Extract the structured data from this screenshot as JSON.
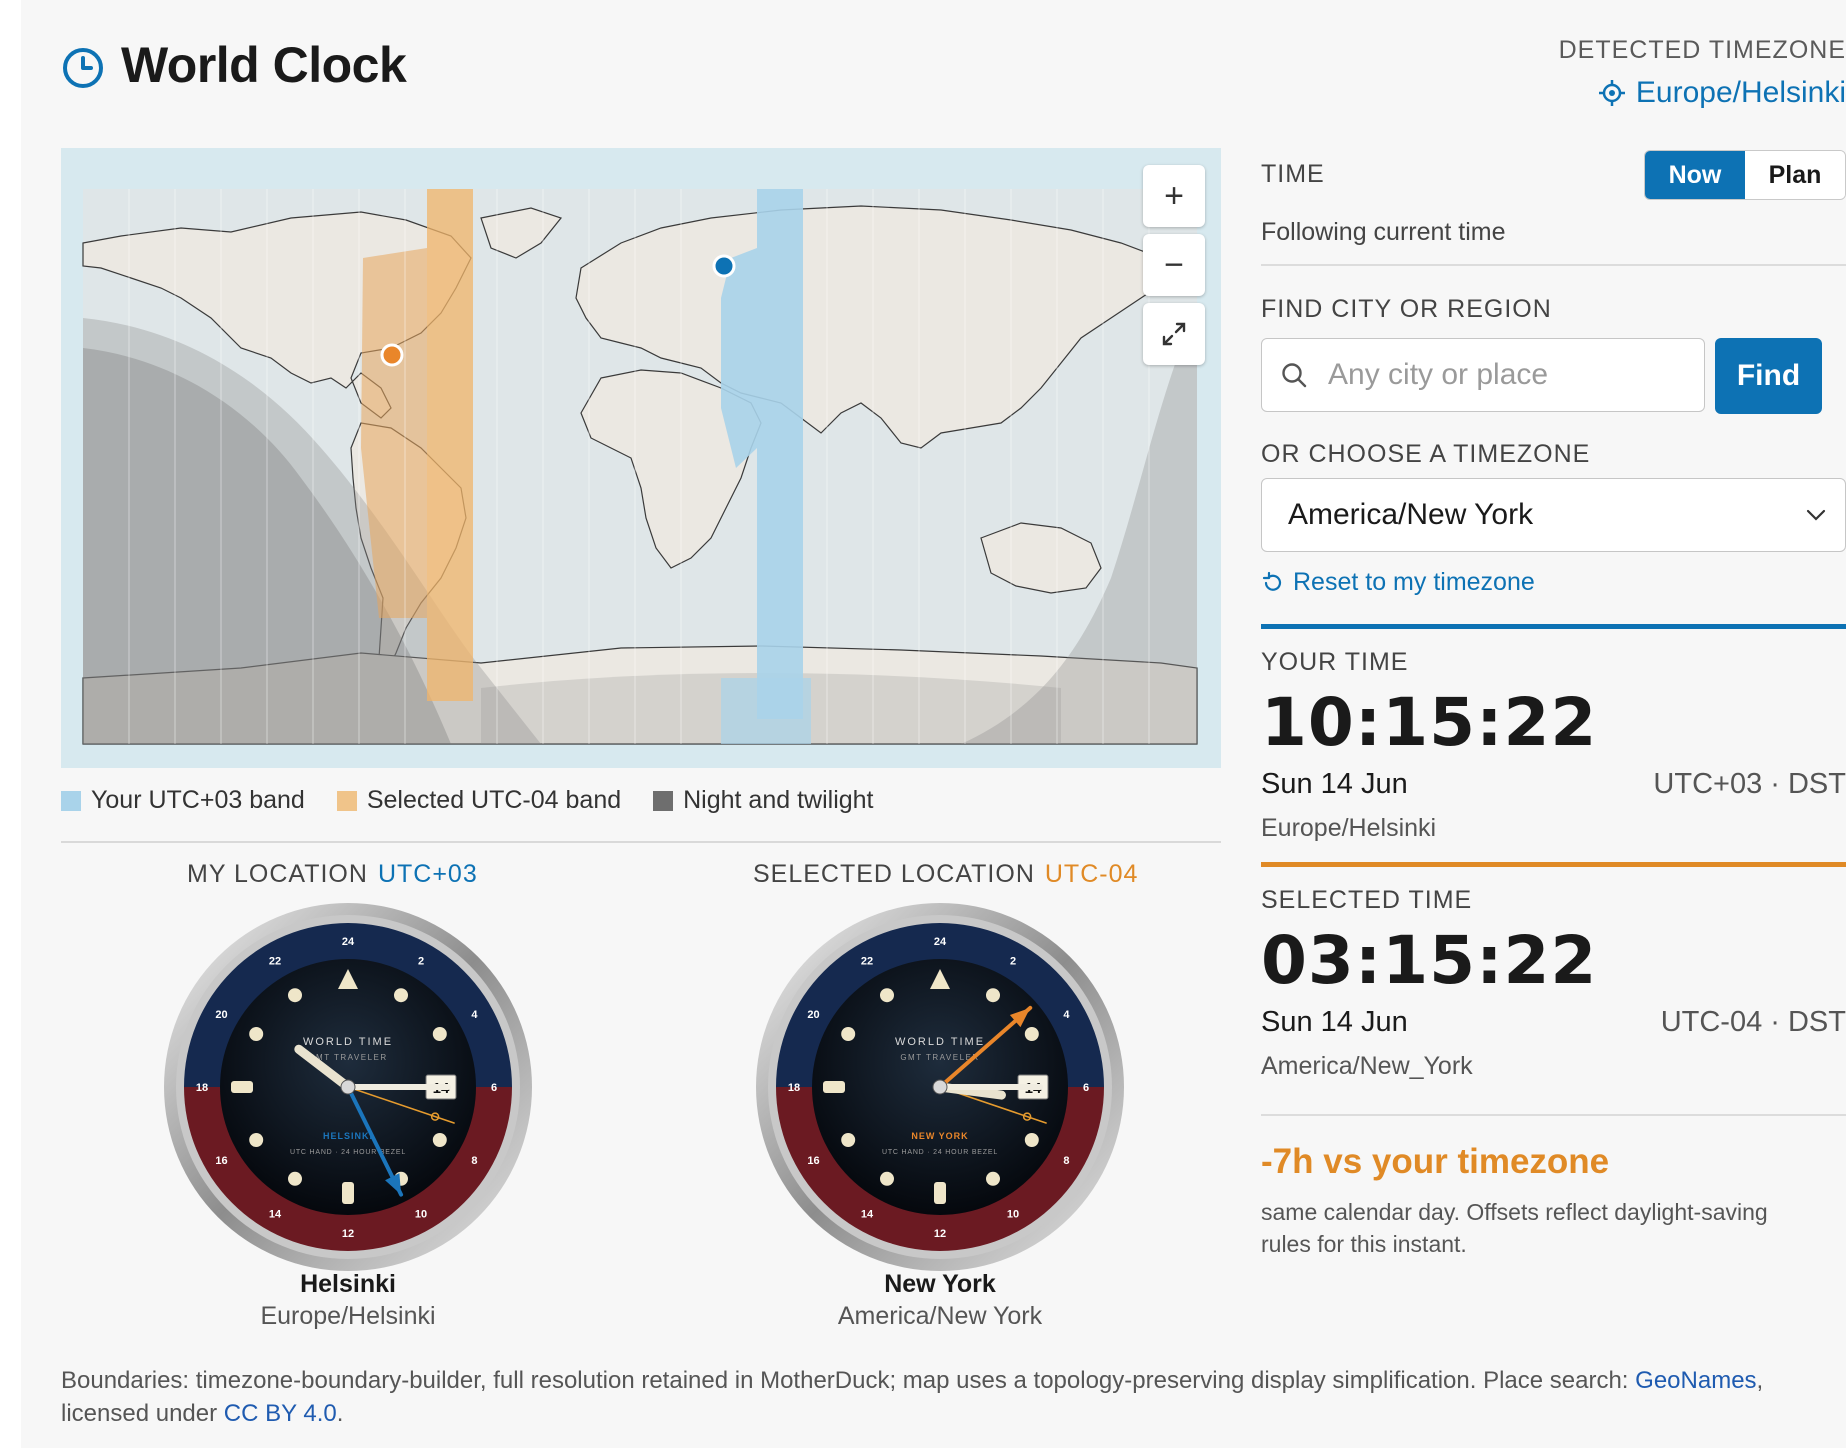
{
  "header": {
    "title": "World Clock",
    "detected_label": "DETECTED TIMEZONE",
    "detected_value": "Europe/Helsinki"
  },
  "map": {
    "zoom_in": "+",
    "zoom_out": "−",
    "legend": {
      "your_band": "Your UTC+03 band",
      "selected_band": "Selected UTC-04 band",
      "night": "Night and twilight"
    },
    "colors": {
      "your_band": "#a9d3ea",
      "selected_band": "#f0c48a",
      "night": "#6e6e6e",
      "ocean": "#d7e9ef",
      "land": "#ebe8e2"
    }
  },
  "clocks": {
    "my": {
      "heading": "MY LOCATION",
      "offset": "UTC+03",
      "city": "Helsinki",
      "tz": "Europe/Helsinki",
      "face_title": "WORLD TIME",
      "face_sub": "GMT TRAVELER",
      "face_city": "HELSINKI",
      "face_note": "UTC HAND · 24 HOUR BEZEL",
      "date_window": "14",
      "bezel": [
        "24",
        "2",
        "4",
        "6",
        "8",
        "10",
        "12",
        "14",
        "16",
        "18",
        "20",
        "22"
      ],
      "hour": 10,
      "minute": 15,
      "utc_hour": 7,
      "accent": "#1b75bb"
    },
    "selected": {
      "heading": "SELECTED LOCATION",
      "offset": "UTC-04",
      "city": "New York",
      "tz": "America/New York",
      "face_title": "WORLD TIME",
      "face_sub": "GMT TRAVELER",
      "face_city": "NEW YORK",
      "face_note": "UTC HAND · 24 HOUR BEZEL",
      "date_window": "14",
      "bezel": [
        "24",
        "2",
        "4",
        "6",
        "8",
        "10",
        "12",
        "14",
        "16",
        "18",
        "20",
        "22"
      ],
      "hour": 3,
      "minute": 15,
      "utc_hour": 7,
      "accent": "#e9862a"
    }
  },
  "panel": {
    "time_label": "TIME",
    "mode_now": "Now",
    "mode_plan": "Plan",
    "following": "Following current time",
    "find_label": "FIND CITY OR REGION",
    "search_placeholder": "Any city or place",
    "find_button": "Find",
    "choose_label": "OR CHOOSE A TIMEZONE",
    "selected_tz": "America/New York",
    "reset": "Reset to my timezone",
    "your": {
      "label": "YOUR TIME",
      "time": "10:15:22",
      "date": "Sun 14 Jun",
      "utc": "UTC+03 · DST",
      "tz": "Europe/Helsinki"
    },
    "selected": {
      "label": "SELECTED TIME",
      "time": "03:15:22",
      "date": "Sun 14 Jun",
      "utc": "UTC-04 · DST",
      "tz": "America/New_York"
    },
    "delta": "-7h vs your timezone",
    "delta_note": "same calendar day. Offsets reflect daylight-saving rules for this instant."
  },
  "footer": {
    "text1": "Boundaries: timezone-boundary-builder, full resolution retained in MotherDuck; map uses a topology-preserving display simplification. Place search: ",
    "link1": "GeoNames",
    "text2": ", licensed under ",
    "link2": "CC BY 4.0",
    "text3": "."
  }
}
